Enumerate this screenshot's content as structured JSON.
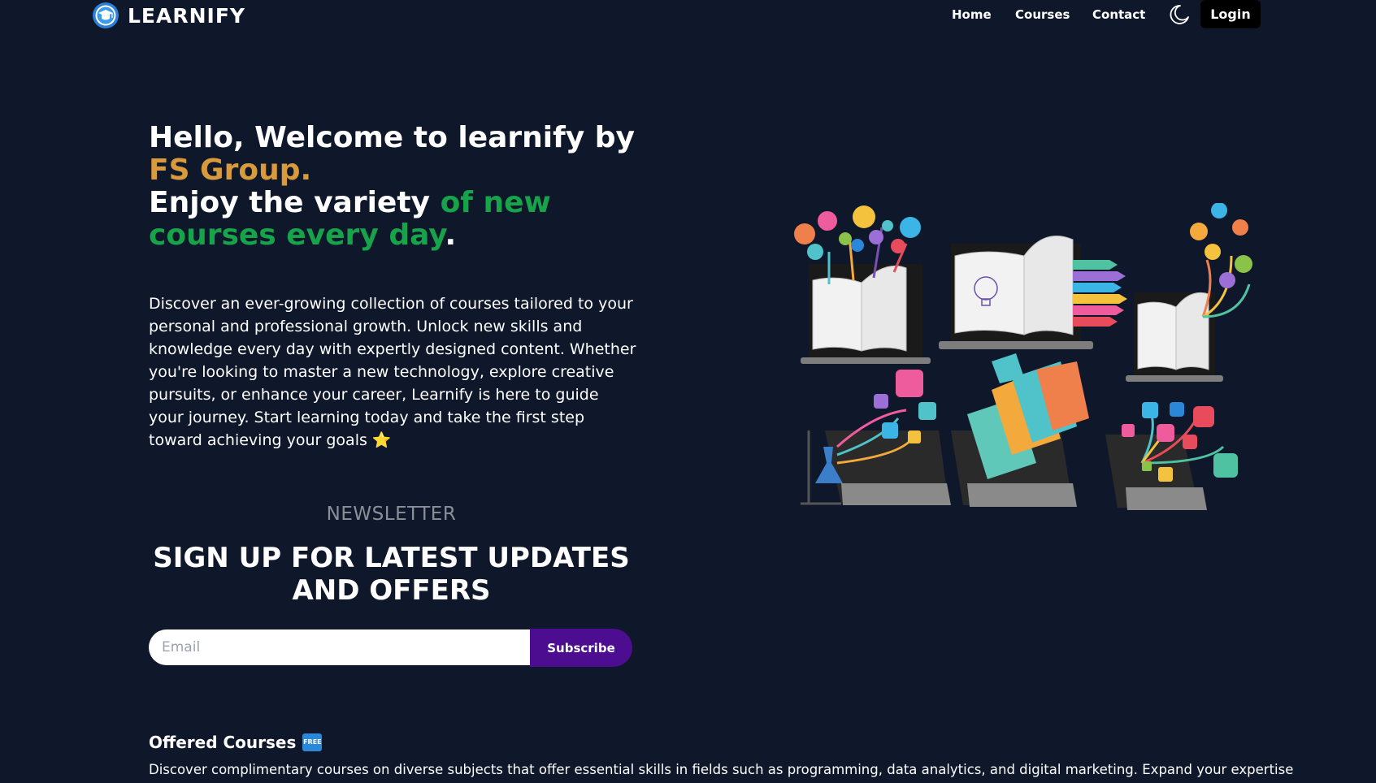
{
  "nav": {
    "brand": "LEARNIFY",
    "links": [
      "Home",
      "Courses",
      "Contact"
    ],
    "login_label": "Login"
  },
  "hero": {
    "title_part1": "Hello, Welcome to learnify by ",
    "title_highlight1": "FS Group.",
    "title_part2": "Enjoy the variety ",
    "title_highlight2": "of new courses every day",
    "title_end": ".",
    "description": "Discover an ever-growing collection of courses tailored to your personal and professional growth. Unlock new skills and knowledge every day with expertly designed content. Whether you're looking to master a new technology, explore creative pursuits, or enhance your career, Learnify is here to guide your journey. Start learning today and take the first step toward achieving your goals ⭐"
  },
  "newsletter": {
    "kicker": "NEWSLETTER",
    "title": "SIGN UP FOR LATEST UPDATES AND OFFERS",
    "email_placeholder": "Email",
    "email_value": "",
    "subscribe_label": "Subscribe"
  },
  "offered": {
    "title": "Offered Courses",
    "badge": "FREE",
    "description": "Discover complimentary courses on diverse subjects that offer essential skills in fields such as programming, data analytics, and digital marketing. Expand your expertise"
  },
  "colors": {
    "background": "#0f172a",
    "accent_orange": "#d99a3b",
    "accent_green": "#16a34a",
    "subscribe_button": "#4c0d91"
  },
  "icons": [
    "graduation-cap-logo-icon",
    "moon-icon",
    "star-icon",
    "free-badge-icon"
  ]
}
